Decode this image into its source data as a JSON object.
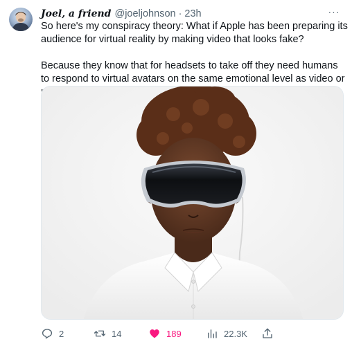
{
  "tweet": {
    "display_name": "Joel, a friend",
    "handle": "@joeljohnson",
    "separator": "·",
    "time": "23h",
    "more_label": "···",
    "paragraphs": [
      "So here's my conspiracy theory: What if Apple has been preparing its audience for virtual reality by making video that looks fake?",
      "Because they know that for headsets to take off they need humans to respond to virtual avatars on the same emotional level as video or real life?"
    ],
    "media": {
      "icon": "photo-woman-wearing-vr-headset"
    },
    "actions": {
      "replies": "2",
      "retweets": "14",
      "likes": "189",
      "views": "22.3K"
    },
    "colors": {
      "like_active": "#f91880",
      "secondary_text": "#536471"
    }
  }
}
